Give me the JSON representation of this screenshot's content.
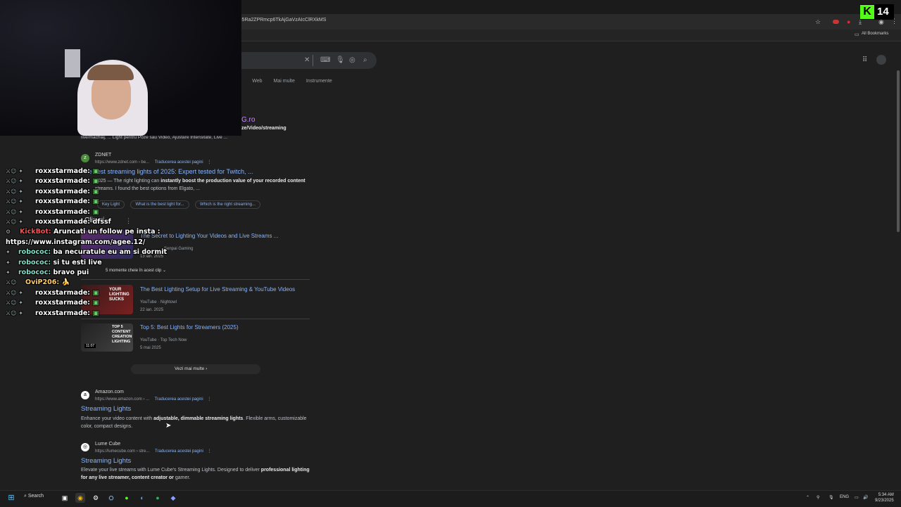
{
  "browser": {
    "url": "i5Ra2ZPRmcp6TkAjGaVzAIcClRXkMS",
    "all_bookmarks": "All Bookmarks"
  },
  "search": {
    "tabs": [
      "Web",
      "Mai multe",
      "Instrumente"
    ]
  },
  "results": {
    "top_partial_title": "G.ro",
    "top_partial_path": "ze/Video/streaming",
    "top_partial_snippet": "live/machiaj, ... Light pentru Poze sau Video, Ajustare Intensitate, Live ...",
    "zdnet": {
      "site": "ZDNET",
      "url": "https://www.zdnet.com › be...",
      "translate": "Traducerea acestei pagini",
      "title": "The best streaming lights of 2025: Expert tested for Twitch, ...",
      "snippet_prefix": "2025 — The right lighting can ",
      "snippet_bold": "instantly boost the production value of your recorded content",
      "snippet_line2": "streams. I found the best options from Elgato, ...",
      "chips": [
        "Key Light",
        "What is the best light for...",
        "Which is the right streaming..."
      ]
    },
    "videos_heading": "Clipuri",
    "videos": [
      {
        "title": "The Secret to Lighting Your Videos and Live Streams ...",
        "source": "Senpai Gaming",
        "date": "13 ian. 2025",
        "moments": "5 momente cheie în acest clip"
      },
      {
        "title": "The Best Lighting Setup for Live Streaming & YouTube Videos",
        "source": "YouTube · Nightowl",
        "date": "22 ian. 2025",
        "thumb_text": "YOUR LIGHTING SUCKS"
      },
      {
        "title": "Top 5: Best Lights for Streamers (2025)",
        "source": "YouTube · Top Tech Now",
        "date": "5 mai 2025",
        "thumb_text": "TOP 5 CONTENT CREATION LIGHTING",
        "duration": "11:07"
      }
    ],
    "see_more": "Vezi mai multe",
    "amazon": {
      "site": "Amazon.com",
      "url": "https://www.amazon.com › ...",
      "translate": "Traducerea acestei pagini",
      "title": "Streaming Lights",
      "snippet_prefix": "Enhance your video content with ",
      "snippet_bold": "adjustable, dimmable streaming lights",
      "snippet_suffix": ". Flexible arms, customizable",
      "snippet_line2": "color, compact designs."
    },
    "lumecube": {
      "site": "Lume Cube",
      "url": "https://lumecube.com › stre...",
      "translate": "Traducerea acestei pagini",
      "title": "Streaming Lights",
      "snippet_prefix": "Elevate your live streams with Lume Cube's Streaming Lights. Designed to deliver ",
      "snippet_bold": "professional lighting",
      "snippet_line2_bold": "for any live streamer, content creator or",
      "snippet_line2_suffix": " gamer."
    }
  },
  "chat": [
    {
      "user": "roxxstarmade:",
      "msg": ""
    },
    {
      "user": "roxxstarmade:",
      "msg": ""
    },
    {
      "user": "roxxstarmade:",
      "msg": ""
    },
    {
      "user": "roxxstarmade:",
      "msg": ""
    },
    {
      "user": "roxxstarmade:",
      "msg": ""
    },
    {
      "user": "roxxstarmade:",
      "msg": "dfssf"
    },
    {
      "user": "KickBot:",
      "msg": "Aruncati un follow pe insta :"
    },
    {
      "user": "",
      "msg": "https://www.instagram.com/agee.12/"
    },
    {
      "user": "robococ:",
      "msg": "ba necuratule eu am si dormit"
    },
    {
      "user": "robococ:",
      "msg": "si tu esti live"
    },
    {
      "user": "robococ:",
      "msg": "bravo pui"
    },
    {
      "user": "OviP206:",
      "msg": "🍌"
    },
    {
      "user": "roxxstarmade:",
      "msg": ""
    },
    {
      "user": "roxxstarmade:",
      "msg": ""
    },
    {
      "user": "roxxstarmade:",
      "msg": ""
    }
  ],
  "kick_widget": {
    "letter": "K",
    "count": "14",
    "color": "#53fc18"
  },
  "taskbar": {
    "search_label": "Search",
    "lang": "ENG",
    "time": "5:34 AM",
    "date": "9/23/2025"
  },
  "colors": {
    "link": "#8ab4f8",
    "background": "#1f1f1f",
    "kick_green": "#53fc18"
  }
}
